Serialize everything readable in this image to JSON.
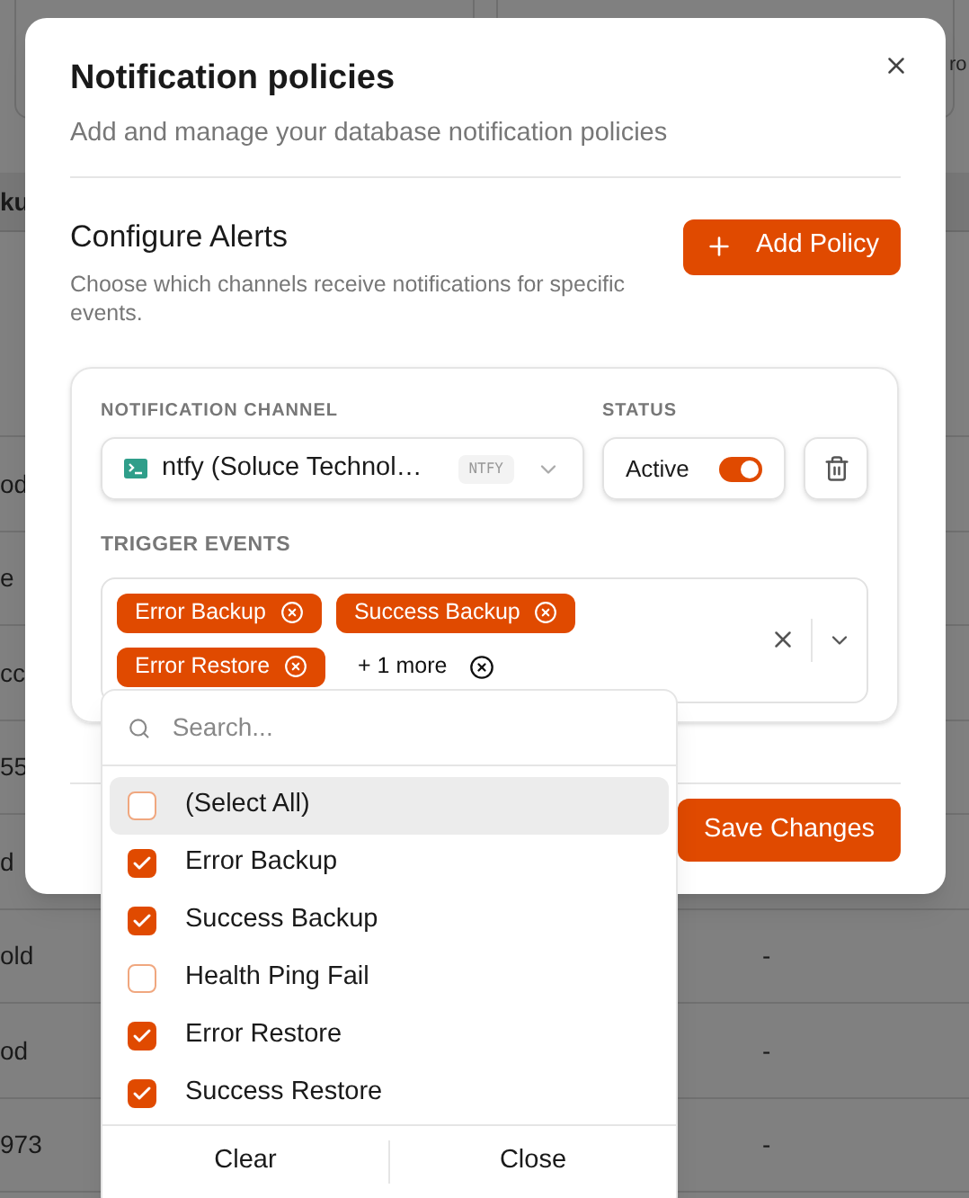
{
  "background": {
    "stat_caption": "ro",
    "header_cell": "ku",
    "rows": [
      {
        "column_1": "od"
      },
      {
        "column_1": "e"
      },
      {
        "column_1": "cc"
      },
      {
        "column_1": "55"
      },
      {
        "column_1": "d"
      },
      {
        "column_1": "old",
        "column_2": "-"
      },
      {
        "column_1": "od",
        "column_2": "-"
      },
      {
        "column_1": "973",
        "column_2": "-"
      }
    ]
  },
  "dialog": {
    "title": "Notification policies",
    "subtitle": "Add and manage your database notification policies",
    "section_title": "Configure Alerts",
    "section_description": "Choose which channels receive notifications for specific events.",
    "add_button": "Add Policy",
    "policy": {
      "channel_label": "NOTIFICATION CHANNEL",
      "channel_value": "ntfy (Soluce Technol…",
      "channel_badge": "NTFY",
      "status_label": "STATUS",
      "status_text": "Active",
      "status_on": true,
      "events_label": "TRIGGER EVENTS",
      "chips": [
        {
          "label": "Error Backup",
          "kind": "tag"
        },
        {
          "label": "Success Backup",
          "kind": "tag"
        },
        {
          "label": "Error Restore",
          "kind": "tag"
        },
        {
          "label": "+ 1 more",
          "kind": "more"
        }
      ]
    },
    "save_button": "Save Changes"
  },
  "dropdown": {
    "search_placeholder": "Search...",
    "options": [
      {
        "label": "(Select All)",
        "checked": false,
        "selected": true
      },
      {
        "label": "Error Backup",
        "checked": true,
        "selected": false
      },
      {
        "label": "Success Backup",
        "checked": true,
        "selected": false
      },
      {
        "label": "Health Ping Fail",
        "checked": false,
        "selected": false
      },
      {
        "label": "Error Restore",
        "checked": true,
        "selected": false
      },
      {
        "label": "Success Restore",
        "checked": true,
        "selected": false
      }
    ],
    "footer_buttons": [
      "Clear",
      "Close"
    ]
  }
}
